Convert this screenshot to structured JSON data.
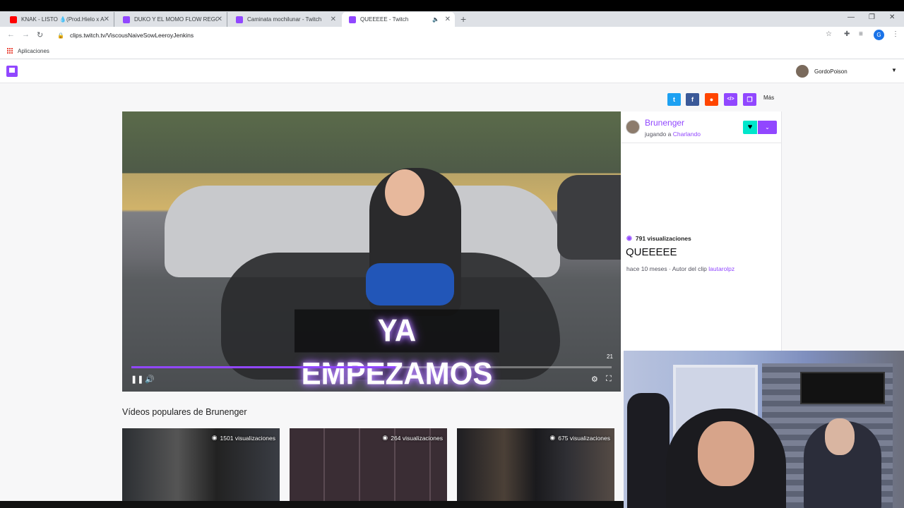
{
  "browser": {
    "tabs": [
      {
        "title": "KNAK - LISTO 💧(Prod.Hielo x Ar",
        "favicon_color": "#ff0000"
      },
      {
        "title": "DUKO Y EL MOMO FLOW REGGA",
        "favicon_color": "#9147ff"
      },
      {
        "title": "Caminata mochilunar - Twitch",
        "favicon_color": "#9147ff"
      },
      {
        "title": "QUEEEEE - Twitch",
        "favicon_color": "#9147ff"
      }
    ],
    "url": "clips.twitch.tv/ViscousNaiveSowLeeroyJenkins",
    "bookmarks_label": "Aplicaciones",
    "profile_initial": "G"
  },
  "header": {
    "username": "GordoPoison"
  },
  "share": {
    "more_label": "Más",
    "buttons": [
      {
        "icon": "twitter-icon",
        "color": "#1da1f2",
        "glyph": "t"
      },
      {
        "icon": "facebook-icon",
        "color": "#3b5998",
        "glyph": "f"
      },
      {
        "icon": "reddit-icon",
        "color": "#ff4500",
        "glyph": "r"
      },
      {
        "icon": "embed-icon",
        "color": "#9147ff",
        "glyph": "</>"
      },
      {
        "icon": "copy-icon",
        "color": "#9147ff",
        "glyph": "❐"
      }
    ]
  },
  "player": {
    "caption": "YA EMPEZAMOS",
    "time_small": "21",
    "progress": 0.55
  },
  "clip": {
    "streamer": "Brunenger",
    "playing_prefix": "jugando a",
    "game": "Charlando",
    "views": "791 visualizaciones",
    "title": "QUEEEEE",
    "meta_prefix": "hace 10 meses · Autor del clip",
    "author": "lautarolpz"
  },
  "popular": {
    "heading": "Vídeos populares de Brunenger",
    "items": [
      {
        "views": "1501 visualizaciones"
      },
      {
        "views": "264 visualizaciones"
      },
      {
        "views": "675 visualizaciones"
      }
    ]
  },
  "colors": {
    "accent": "#9147ff",
    "follow": "#00e6cb"
  }
}
